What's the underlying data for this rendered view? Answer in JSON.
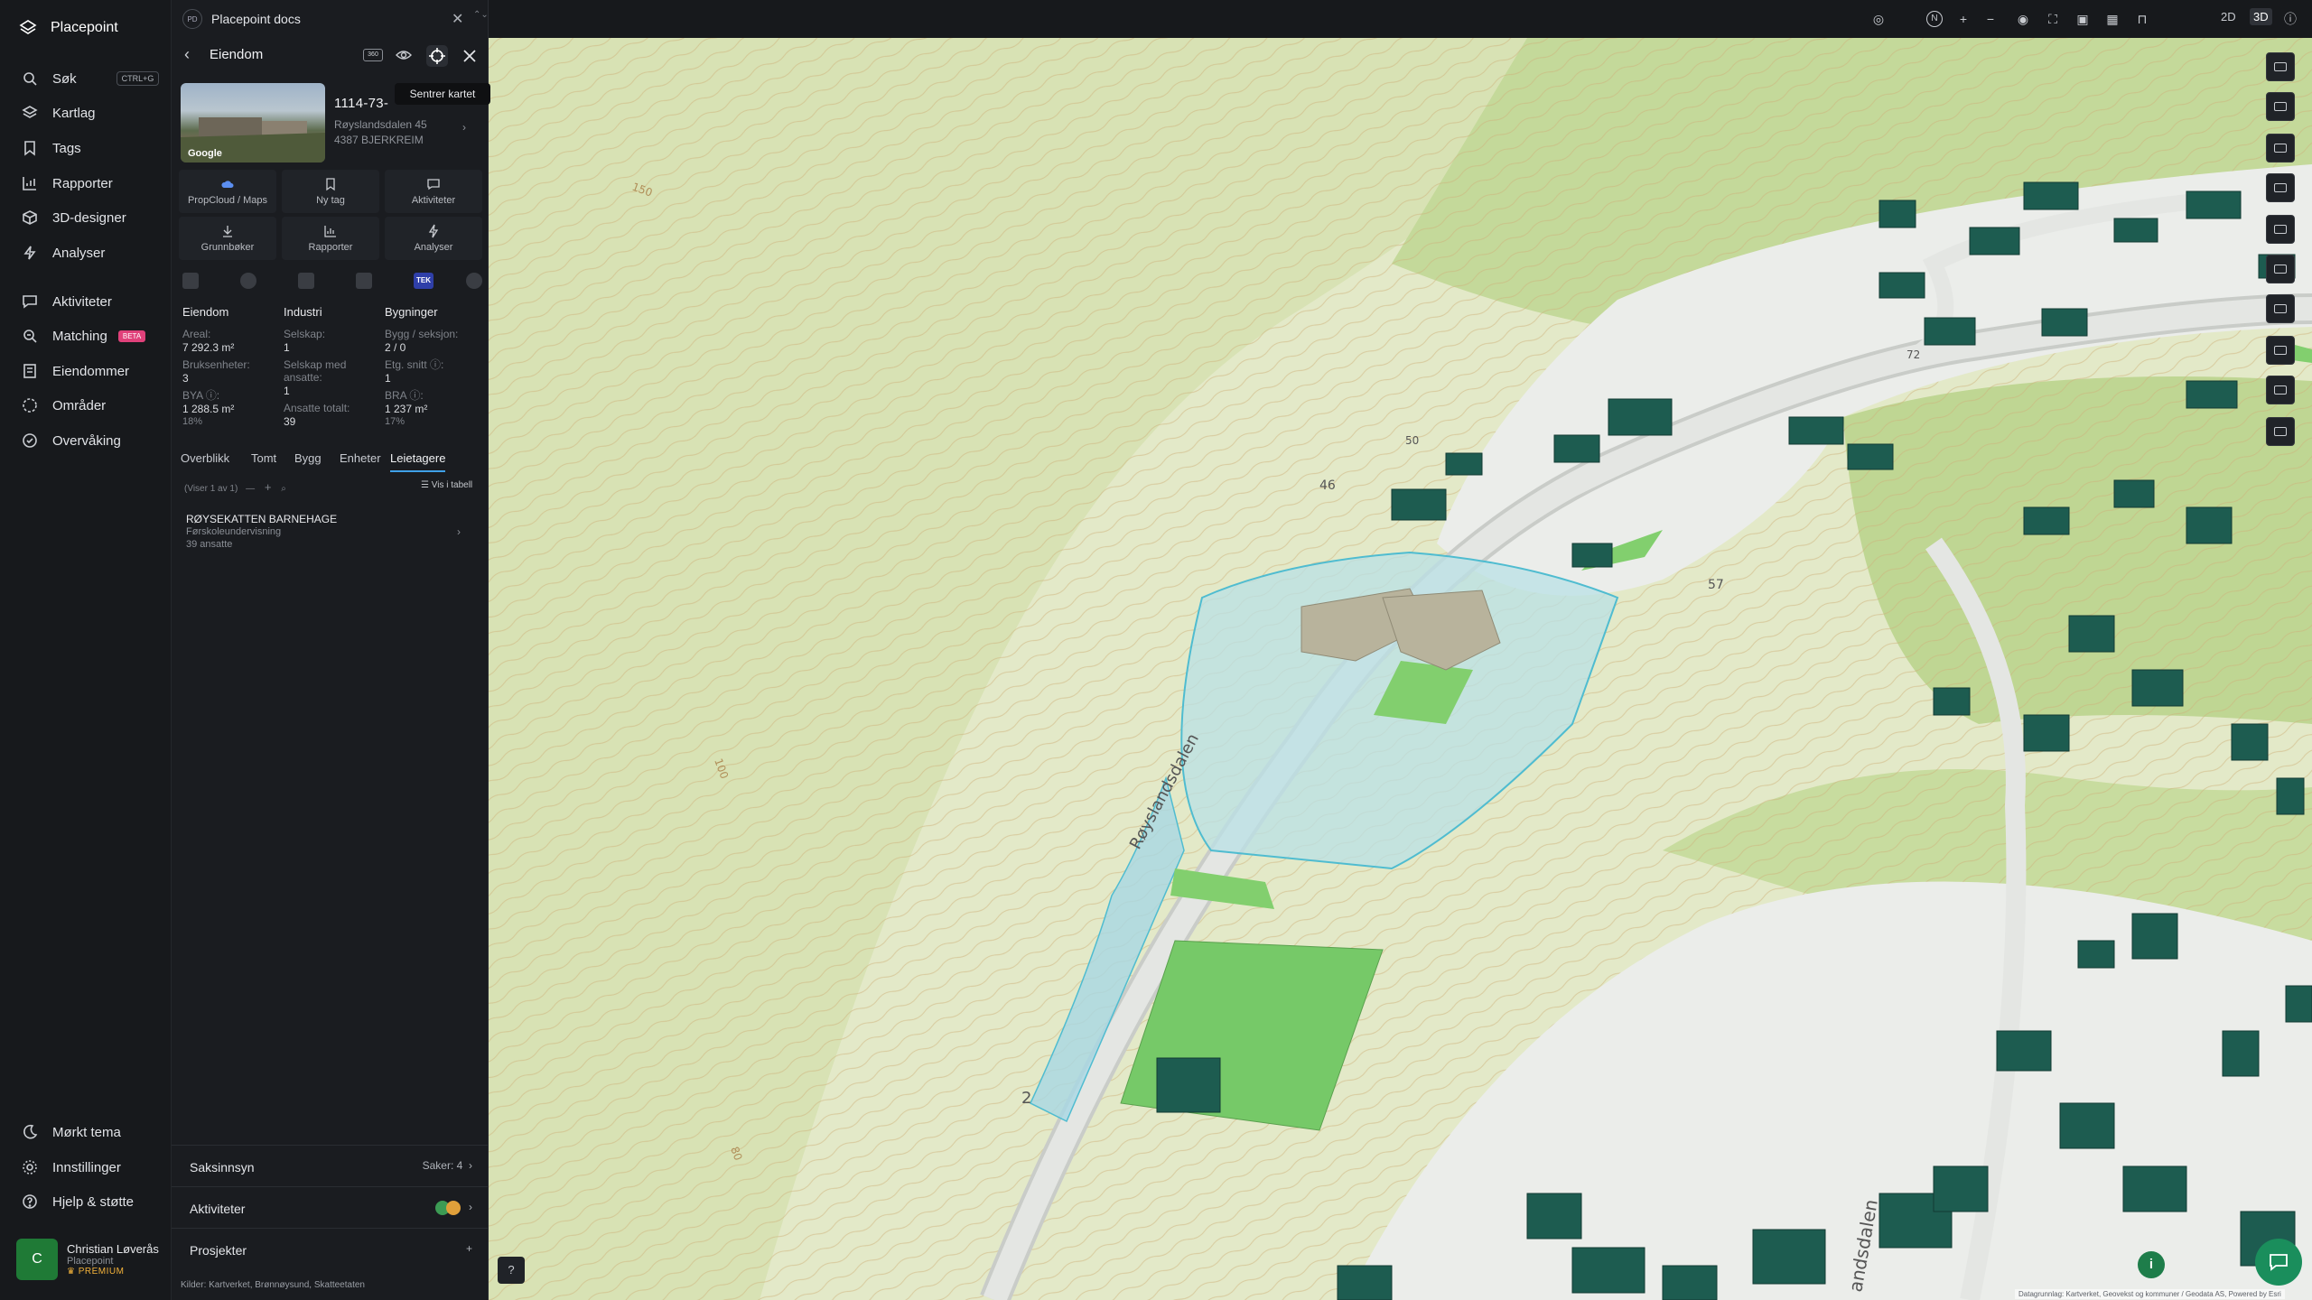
{
  "app": {
    "brand": "Placepoint"
  },
  "nav": {
    "search": {
      "label": "Søk",
      "shortcut": "CTRL+G"
    },
    "items": [
      {
        "label": "Kartlag",
        "icon": "layers-icon"
      },
      {
        "label": "Tags",
        "icon": "bookmark-icon"
      },
      {
        "label": "Rapporter",
        "icon": "chart-icon"
      },
      {
        "label": "3D-designer",
        "icon": "cube-icon"
      },
      {
        "label": "Analyser",
        "icon": "bolt-icon"
      }
    ],
    "items2": [
      {
        "label": "Aktiviteter",
        "icon": "chat-icon"
      },
      {
        "label": "Matching",
        "icon": "match-icon",
        "badge": "BETA"
      },
      {
        "label": "Eiendommer",
        "icon": "building-icon"
      },
      {
        "label": "Områder",
        "icon": "area-icon"
      },
      {
        "label": "Overvåking",
        "icon": "monitor-icon"
      }
    ],
    "bottom": [
      {
        "label": "Mørkt tema",
        "icon": "moon-icon"
      },
      {
        "label": "Innstillinger",
        "icon": "gear-icon"
      },
      {
        "label": "Hjelp & støtte",
        "icon": "help-icon"
      }
    ],
    "user": {
      "initial": "C",
      "name": "Christian Løverås",
      "org": "Placepoint",
      "plan": "PREMIUM"
    }
  },
  "panel": {
    "doc": {
      "logo": "PD",
      "title": "Placepoint docs"
    },
    "header": {
      "title": "Eiendom",
      "badge": "360"
    },
    "tooltip": "Sentrer kartet",
    "property": {
      "id": "1114-73-",
      "address": "Røyslandsdalen 45",
      "postal": "4387 BJERKREIM",
      "image_label": "Google"
    },
    "actions": [
      {
        "label": "PropCloud / Maps"
      },
      {
        "label": "Ny tag"
      },
      {
        "label": "Aktiviteter"
      },
      {
        "label": "Grunnbøker"
      },
      {
        "label": "Rapporter"
      },
      {
        "label": "Analyser"
      }
    ],
    "tek_label": "TEK",
    "stats": {
      "eiendom": {
        "title": "Eiendom",
        "areal_l": "Areal:",
        "areal_v": "7 292.3 m²",
        "bruks_l": "Bruksenheter:",
        "bruks_v": "3",
        "bya_l": "BYA ⓘ:",
        "bya_v": "1 288.5 m²",
        "bya_p": "18%"
      },
      "industri": {
        "title": "Industri",
        "sel_l": "Selskap:",
        "sel_v": "1",
        "selans_l": "Selskap med ansatte:",
        "selans_v": "1",
        "ans_l": "Ansatte totalt:",
        "ans_v": "39"
      },
      "bygninger": {
        "title": "Bygninger",
        "bygg_l": "Bygg / seksjon:",
        "bygg_v": "2 / 0",
        "etg_l": "Etg. snitt ⓘ:",
        "etg_v": "1",
        "bra_l": "BRA ⓘ:",
        "bra_v": "1 237 m²",
        "bra_p": "17%"
      }
    },
    "tabs": [
      "Overblikk",
      "Tomt",
      "Bygg",
      "Enheter",
      "Leietagere"
    ],
    "subbar": {
      "count": "(Viser 1 av 1)",
      "view": "Vis i tabell"
    },
    "tenant": {
      "name": "RØYSEKATTEN BARNEHAGE",
      "type": "Førskoleundervisning",
      "employees": "39 ansatte"
    },
    "sections": [
      {
        "label": "Saksinnsyn",
        "right": "Saker: 4"
      },
      {
        "label": "Aktiviteter",
        "right": ""
      },
      {
        "label": "Prosjekter",
        "right": "+"
      }
    ],
    "sources": "Kilder: Kartverket, Brønnøysund, Skatteetaten"
  },
  "topbar": {
    "north": "N",
    "mode2d": "2D",
    "mode3d": "3D"
  },
  "map": {
    "road_labels": [
      "Røyslandsdalen",
      "andsdalen"
    ],
    "numbers": [
      "150",
      "100",
      "80",
      "2",
      "57",
      "46",
      "50",
      "72"
    ],
    "credit": "Datagrunnlag: Kartverket, Geovekst og kommuner / Geodata AS, Powered by Esri",
    "colors": {
      "terrain": "#dde6c1",
      "forest": "#b9d18e",
      "building": "#1d5c50",
      "parcel": "#aee0ea",
      "field": "#7ccf74"
    }
  }
}
